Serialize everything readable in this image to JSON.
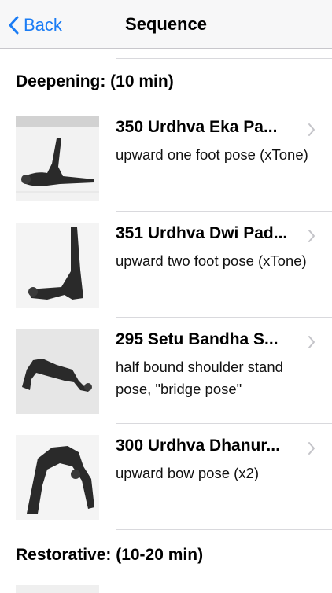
{
  "navbar": {
    "back_label": "Back",
    "title": "Sequence"
  },
  "sections": [
    {
      "header": "Deepening: (10 min)",
      "items": [
        {
          "title": "350 Urdhva Eka Pa...",
          "subtitle": "upward one foot pose (xTone)",
          "thumbnail_icon": "pose-photo-icon"
        },
        {
          "title": "351 Urdhva Dwi Pad...",
          "subtitle": "upward two foot pose (xTone)",
          "thumbnail_icon": "pose-photo-icon"
        },
        {
          "title": "295 Setu Bandha S...",
          "subtitle": "half bound shoulder stand pose, \"bridge pose\"",
          "thumbnail_icon": "pose-photo-icon"
        },
        {
          "title": "300 Urdhva Dhanur...",
          "subtitle": "upward bow pose (x2)",
          "thumbnail_icon": "pose-photo-icon"
        }
      ]
    },
    {
      "header": "Restorative: (10-20 min)",
      "items": []
    }
  ],
  "colors": {
    "accent": "#1a7cf5",
    "separator": "#d9d9dd",
    "chevron": "#c4c4c9",
    "navbar_bg": "#f7f7f8"
  }
}
